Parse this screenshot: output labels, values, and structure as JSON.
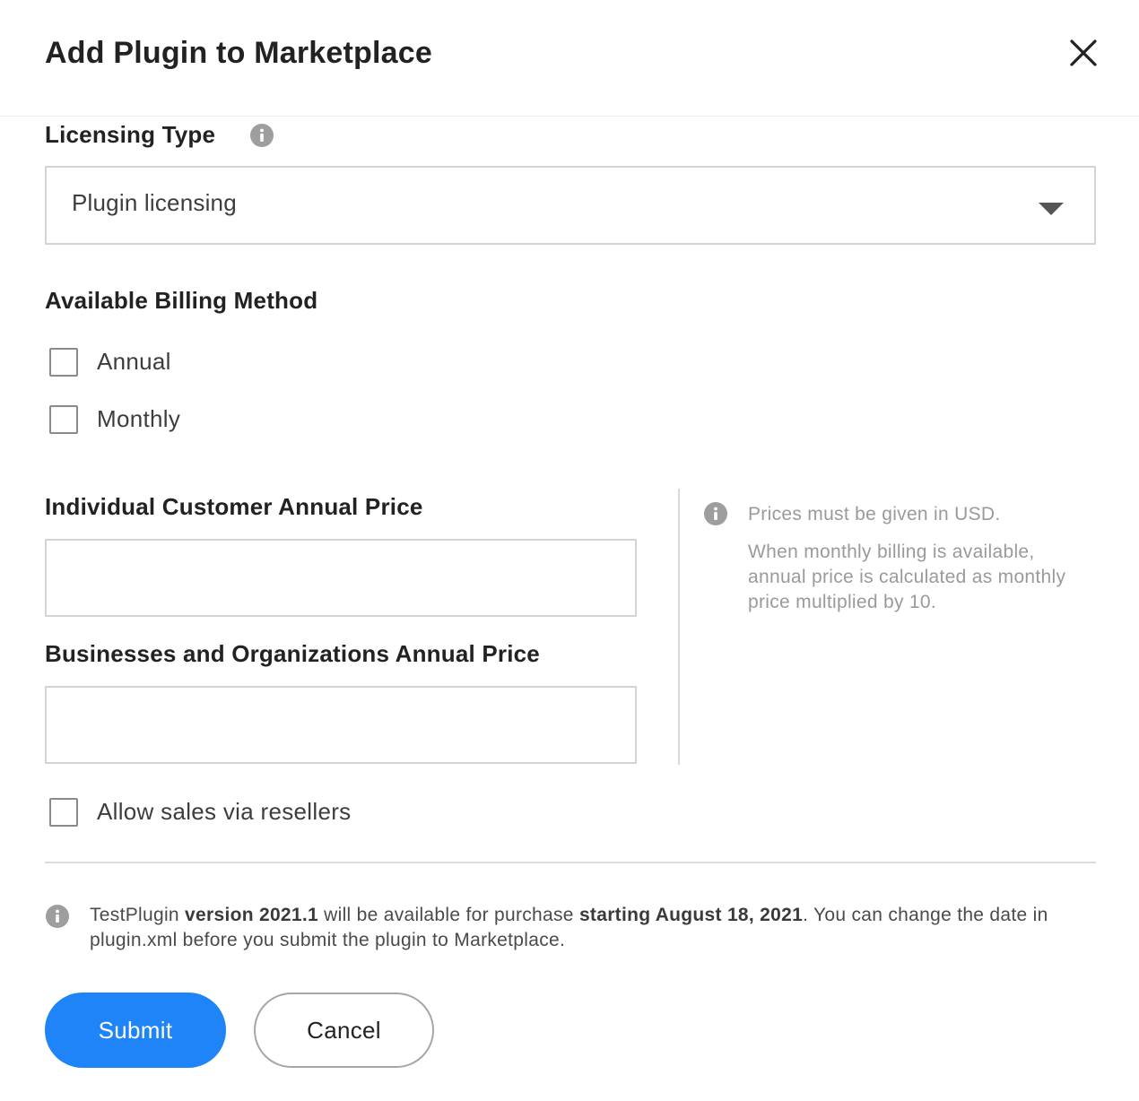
{
  "dialog": {
    "title": "Add Plugin to Marketplace"
  },
  "licensing": {
    "label": "Licensing Type",
    "selected": "Plugin licensing"
  },
  "billing": {
    "label": "Available Billing Method",
    "options": [
      {
        "label": "Annual",
        "checked": false
      },
      {
        "label": "Monthly",
        "checked": false
      }
    ]
  },
  "pricing": {
    "individual_label": "Individual Customer Annual Price",
    "individual_value": "",
    "business_label": "Businesses and Organizations Annual Price",
    "business_value": "",
    "hint_line1": "Prices must be given in USD.",
    "hint_line2": "When monthly billing is available, annual price is calculated as monthly price multiplied by 10."
  },
  "resellers": {
    "label": "Allow sales via resellers",
    "checked": false
  },
  "notice": {
    "plugin_name": "TestPlugin",
    "version": "version 2021.1",
    "middle": "will be available for purchase",
    "start": "starting August 18, 2021",
    "tail": ". You can change the date in plugin.xml before you submit the plugin to Marketplace."
  },
  "actions": {
    "submit": "Submit",
    "cancel": "Cancel"
  },
  "colors": {
    "accent": "#1f84f7",
    "info_icon": "#9e9e9e"
  },
  "icons": [
    "close-icon",
    "info-icon",
    "chevron-down-icon"
  ]
}
